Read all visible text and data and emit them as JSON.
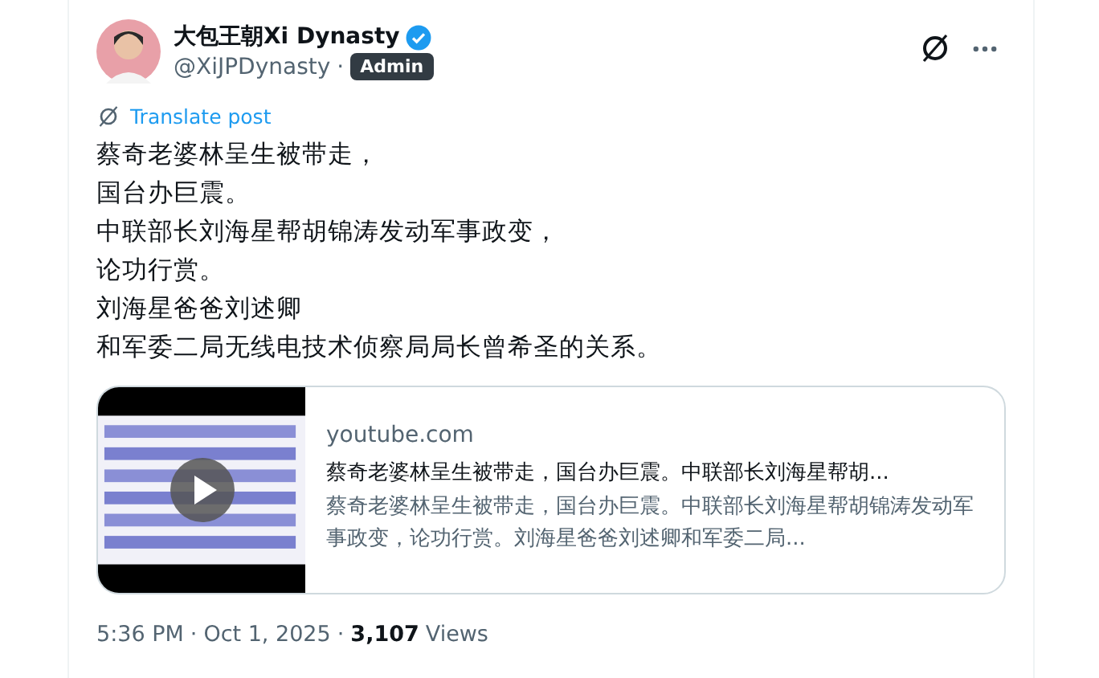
{
  "author": {
    "name": "大包王朝Xi Dynasty",
    "verified": true,
    "handle": "@XiJPDynasty",
    "separator": "·",
    "badge": "Admin"
  },
  "translate_link": "Translate post",
  "body_lines": [
    "蔡奇老婆林呈生被带走，",
    "国台办巨震。",
    "中联部长刘海星帮胡锦涛发动军事政变，",
    "论功行赏。",
    "刘海星爸爸刘述卿",
    "和军委二局无线电技术侦察局局长曾希圣的关系。"
  ],
  "link_card": {
    "domain": "youtube.com",
    "title": "蔡奇老婆林呈生被带走，国台办巨震。中联部长刘海星帮胡...",
    "description": "蔡奇老婆林呈生被带走，国台办巨震。中联部长刘海星帮胡锦涛发动军事政变，论功行赏。刘海星爸爸刘述卿和军委二局..."
  },
  "footer": {
    "time": "5:36 PM",
    "sep1": "·",
    "date": "Oct 1, 2025",
    "sep2": "·",
    "views_count": "3,107",
    "views_label": "Views"
  }
}
